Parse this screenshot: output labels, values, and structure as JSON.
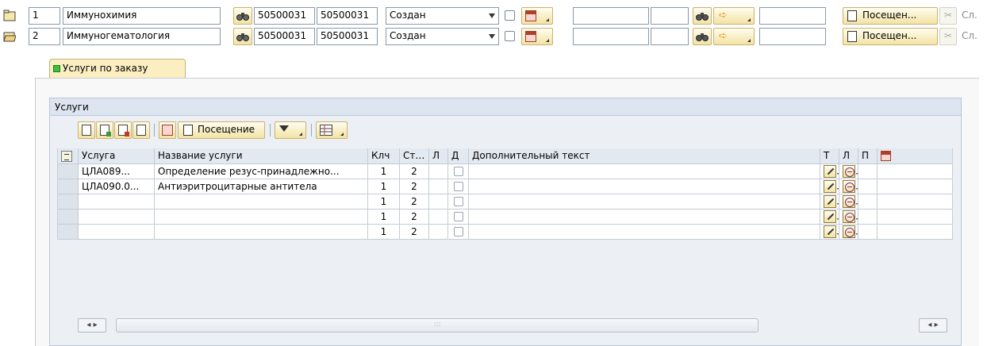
{
  "requests": [
    {
      "index": "1",
      "name": "Иммунохимия",
      "code_a": "50500031",
      "code_b": "50500031",
      "status": "Создан",
      "visit_label": "Посещен...",
      "extra_label": "Сл."
    },
    {
      "index": "2",
      "name": "Иммуногематология",
      "code_a": "50500031",
      "code_b": "50500031",
      "status": "Создан",
      "visit_label": "Посещен...",
      "extra_label": "Сл."
    }
  ],
  "tab": {
    "label": "Услуги по заказу"
  },
  "services_group": {
    "title": "Услуги",
    "toolbar": {
      "visit_label": "Посещение"
    },
    "columns": [
      "Услуга",
      "Название услуги",
      "Клч",
      "Ста...",
      "Л",
      "Д",
      "Дополнительный текст",
      "Т",
      "Л",
      "П"
    ],
    "rows": [
      {
        "service": "ЦЛА089...",
        "name": "Определение резус-принадлежно...",
        "klch": "1",
        "status": "2"
      },
      {
        "service": "ЦЛА090.0...",
        "name": "Антиэритроцитарные антитела",
        "klch": "1",
        "status": "2"
      },
      {
        "service": "",
        "name": "",
        "klch": "1",
        "status": "2"
      },
      {
        "service": "",
        "name": "",
        "klch": "1",
        "status": "2"
      },
      {
        "service": "",
        "name": "",
        "klch": "1",
        "status": "2"
      }
    ]
  },
  "scrollbar": {
    "grip": ":::"
  },
  "icons": {
    "row_icon": "folder-icon",
    "binoculars": "binoculars-icon",
    "calendar": "calendar-icon",
    "arrow": "arrow-right-icon",
    "document": "document-icon",
    "cut": "scissors-icon"
  },
  "colors": {
    "button_bg": "#f3e3a4",
    "tab_bg": "#fbefc2",
    "group_header": "#dde6f0",
    "green_status": "#3ec03b"
  }
}
